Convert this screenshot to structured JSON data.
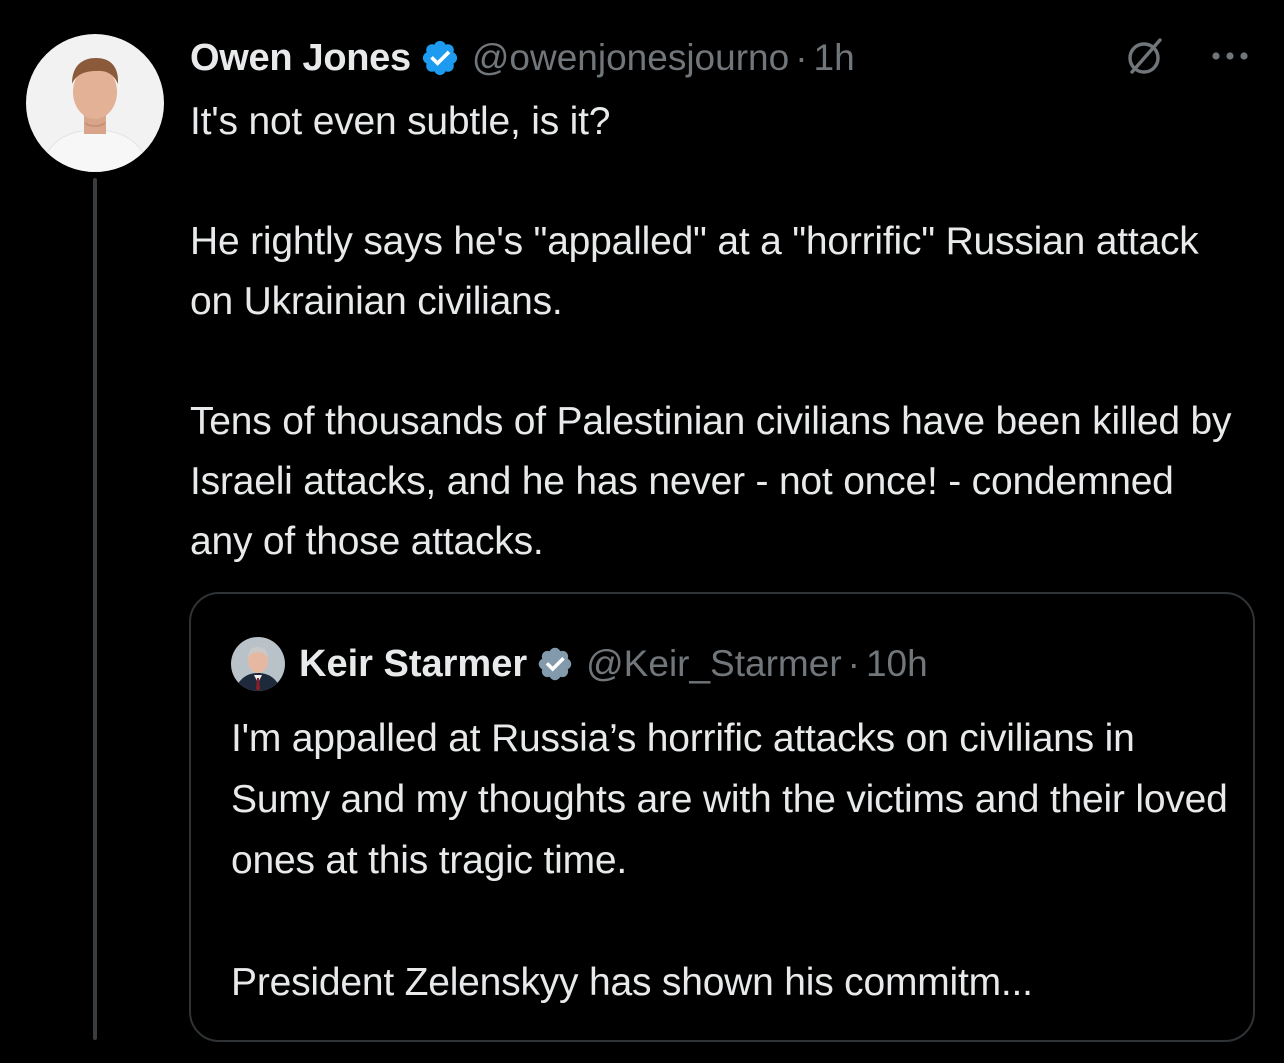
{
  "author": {
    "name": "Owen Jones",
    "handle": "@owenjonesjourno",
    "separator": "·",
    "time": "1h",
    "verified_color": "#1d9bf0"
  },
  "tweet": {
    "paragraphs": [
      "It's not even subtle, is it?",
      "He rightly says he's \"appalled\" at a \"horrific\" Russian attack on Ukrainian civilians.",
      "Tens of thousands of Palestinian civilians have been killed by Israeli attacks, and he has never - not once! - condemned any of those attacks."
    ]
  },
  "icons": {
    "grok": "grok-icon",
    "more": "more-options-icon",
    "verified": "verified-badge-icon"
  },
  "quote": {
    "name": "Keir Starmer",
    "handle": "@Keir_Starmer",
    "separator": "·",
    "time": "10h",
    "verified_color": "#829aab",
    "paragraphs": [
      "I'm appalled at Russia’s horrific attacks on civilians in Sumy and my thoughts are with the victims and their loved ones at this tragic time.",
      "President Zelenskyy has shown his commitm..."
    ]
  },
  "colors": {
    "background": "#000000",
    "text": "#e7e9ea",
    "secondary_text": "#71767b",
    "border": "#2f3336"
  }
}
